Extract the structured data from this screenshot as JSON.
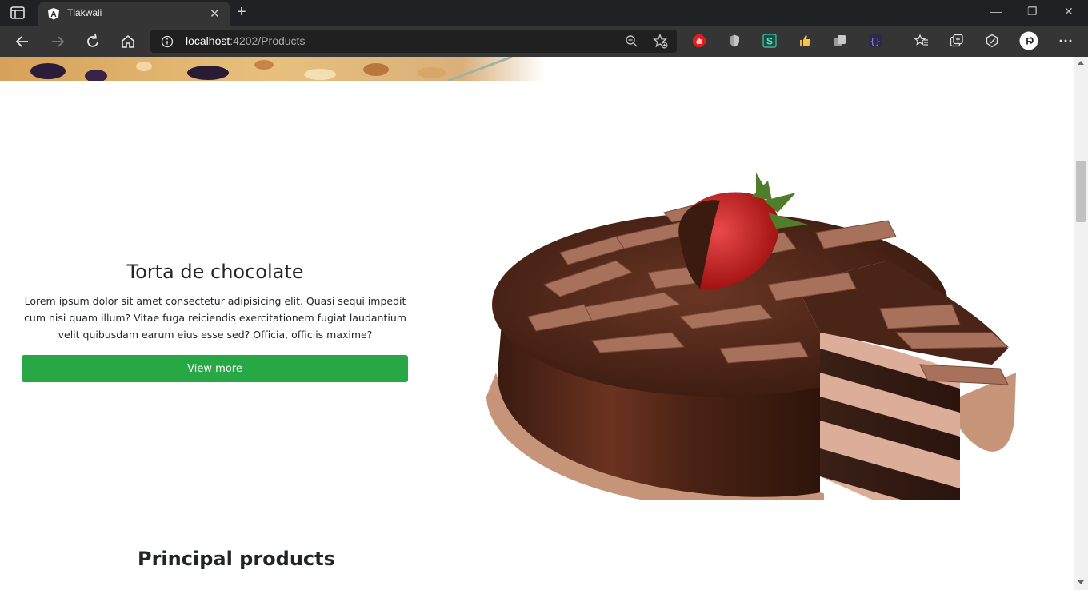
{
  "browser": {
    "tab_title": "Tlakwali",
    "tab_close": "✕",
    "new_tab": "+",
    "window_controls": [
      "—",
      "❐",
      "✕"
    ],
    "url_host": "localhost",
    "url_rest": ":4202/Products",
    "extensions": [
      "adblock-icon",
      "shield-icon",
      "s-extension-icon",
      "thumbs-up-icon",
      "copy-extension-icon",
      "brackets-extension-icon",
      "favorites-icon",
      "collections-icon",
      "performance-icon",
      "profile-icon",
      "more-icon"
    ]
  },
  "product": {
    "title": "Torta de chocolate",
    "description": "Lorem ipsum dolor sit amet consectetur adipisicing elit. Quasi sequi impedit cum nisi quam illum? Vitae fuga reiciendis exercitationem fugiat laudantium velit quibusdam earum eius esse sed? Officia, officiis maxime?",
    "button_label": "View more",
    "button_color": "#28a745"
  },
  "section": {
    "title": "Principal products"
  }
}
